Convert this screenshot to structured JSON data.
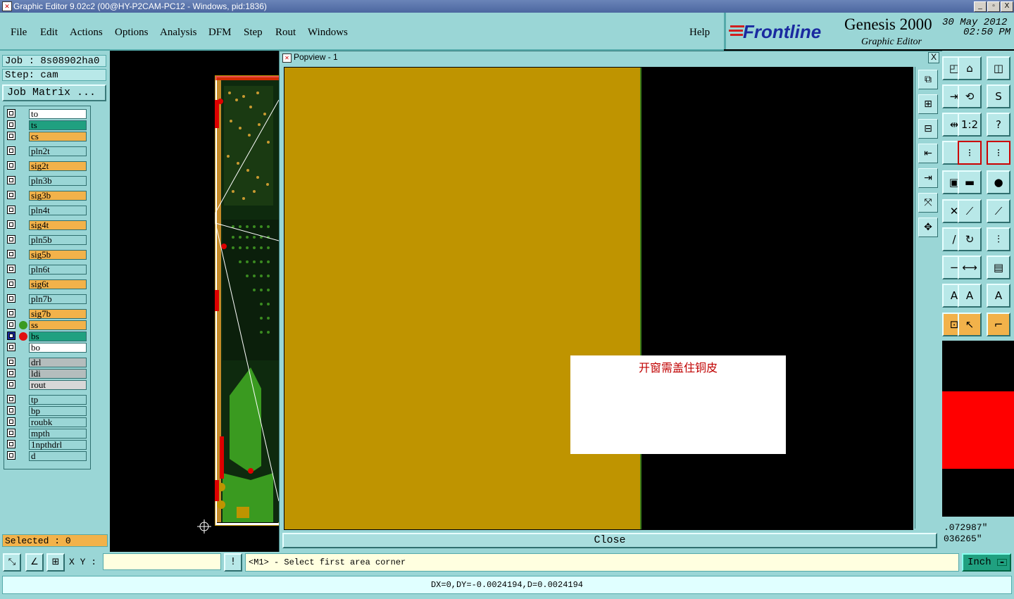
{
  "window": {
    "title": "Graphic Editor 9.02c2 (00@HY-P2CAM-PC12 - Windows, pid:1836)",
    "buttons": [
      "_",
      "▫",
      "X"
    ]
  },
  "menu": [
    "File",
    "Edit",
    "Actions",
    "Options",
    "Analysis",
    "DFM",
    "Step",
    "Rout",
    "Windows"
  ],
  "help_label": "Help",
  "brand": {
    "logo": "Frontline",
    "product": "Genesis 2000",
    "subtitle": "Graphic Editor",
    "date": "30 May 2012",
    "time": "02:50 PM"
  },
  "job": {
    "job_label": "Job : 8s08902ha0",
    "step_label": "Step: cam",
    "matrix_button": "Job Matrix ..."
  },
  "layers": [
    {
      "name": "to",
      "color": "white"
    },
    {
      "name": "ts",
      "color": "teal"
    },
    {
      "name": "cs",
      "color": "orange"
    },
    {
      "name": "pln2t",
      "color": "cyan"
    },
    {
      "name": "sig2t",
      "color": "orange"
    },
    {
      "name": "pln3b",
      "color": "cyan"
    },
    {
      "name": "sig3b",
      "color": "orange"
    },
    {
      "name": "pln4t",
      "color": "cyan"
    },
    {
      "name": "sig4t",
      "color": "orange"
    },
    {
      "name": "pln5b",
      "color": "cyan"
    },
    {
      "name": "sig5b",
      "color": "orange"
    },
    {
      "name": "pln6t",
      "color": "cyan"
    },
    {
      "name": "sig6t",
      "color": "orange"
    },
    {
      "name": "pln7b",
      "color": "cyan"
    },
    {
      "name": "sig7b",
      "color": "orange"
    },
    {
      "name": "ss",
      "color": "orange"
    },
    {
      "name": "bs",
      "color": "teal"
    },
    {
      "name": "bo",
      "color": "white"
    },
    {
      "name": "drl",
      "color": "gray"
    },
    {
      "name": "ldi",
      "color": "gray"
    },
    {
      "name": "rout",
      "color": "lgray"
    },
    {
      "name": "tp",
      "color": "cyan"
    },
    {
      "name": "bp",
      "color": "cyan"
    },
    {
      "name": "roubk",
      "color": "cyan"
    },
    {
      "name": "mpth",
      "color": "cyan"
    },
    {
      "name": "1npthdrl",
      "color": "cyan"
    },
    {
      "name": "d",
      "color": "cyan"
    }
  ],
  "selected_label": "Selected : 0",
  "popview": {
    "title": "Popview - 1",
    "close_x": "X",
    "close_button": "Close",
    "note_text": "开窗需盖住铜皮"
  },
  "coords": {
    "x": ".072987\"",
    "y": "036265\""
  },
  "command": {
    "xy_label": "X Y :",
    "xy_value": "",
    "exclaim": "!",
    "prompt": "<M1> - Select first area corner",
    "unit": "Inch"
  },
  "status": "DX=0,DY=-0.0024194,D=0.0024194",
  "colors": {
    "panel": "#9ad6d6",
    "copper": "#bf9400",
    "accent_orange": "#f2b24a",
    "accent_teal": "#20a080",
    "note_red": "#c00000"
  }
}
